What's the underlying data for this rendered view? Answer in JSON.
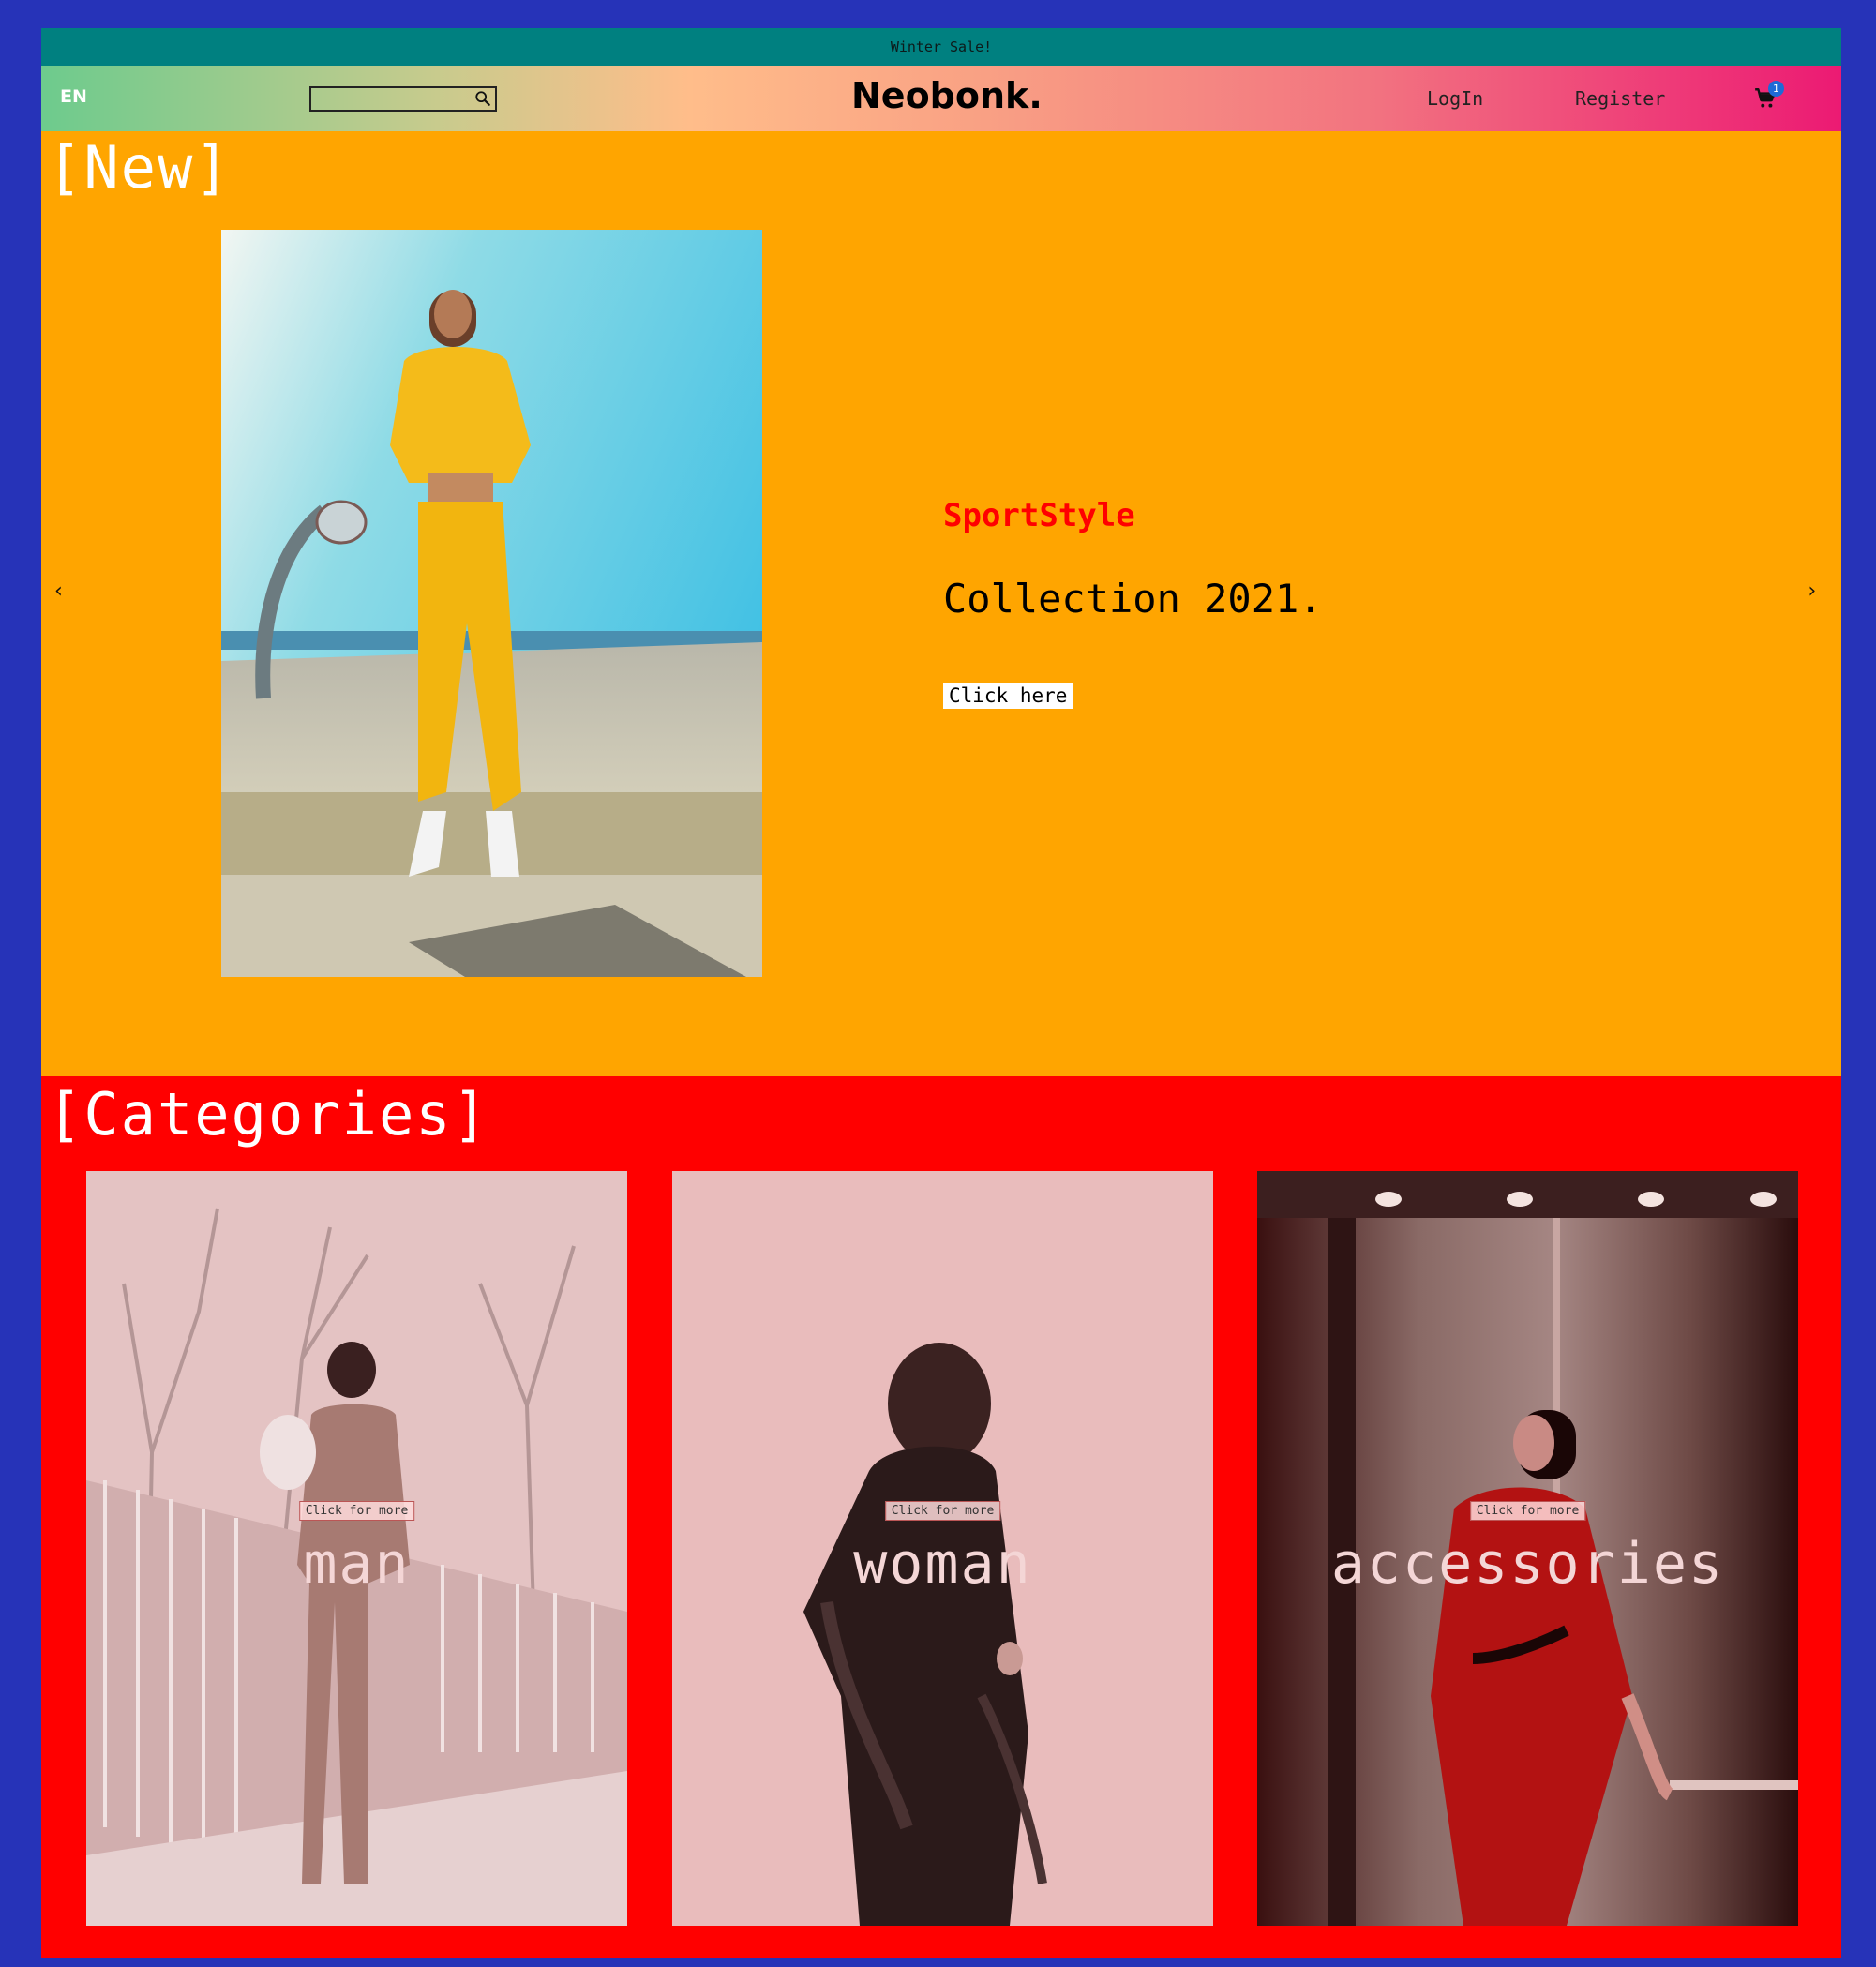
{
  "announcement": "Winter Sale!",
  "navbar": {
    "language": "EN",
    "search_placeholder": "",
    "logo": "Neobonk.",
    "login": "LogIn",
    "register": "Register",
    "cart_count": "1"
  },
  "new_section": {
    "title": "[New]",
    "prev_arrow": "‹",
    "next_arrow": "›",
    "slide": {
      "brand": "SportStyle",
      "heading": "Collection 2021.",
      "cta": "Click here"
    }
  },
  "categories": {
    "title": "[Categories]",
    "items": [
      {
        "label": "man",
        "cta": "Click for more"
      },
      {
        "label": "woman",
        "cta": "Click for more"
      },
      {
        "label": "accessories",
        "cta": "Click for more"
      }
    ]
  },
  "colors": {
    "background": "#2633b8",
    "announcement_bg": "#008080",
    "new_section_bg": "#ffa500",
    "categories_bg": "#ff0000",
    "brand_text": "#ff0000"
  },
  "icons": {
    "search": "search-icon",
    "cart": "cart-icon",
    "prev": "chevron-left-icon",
    "next": "chevron-right-icon"
  }
}
